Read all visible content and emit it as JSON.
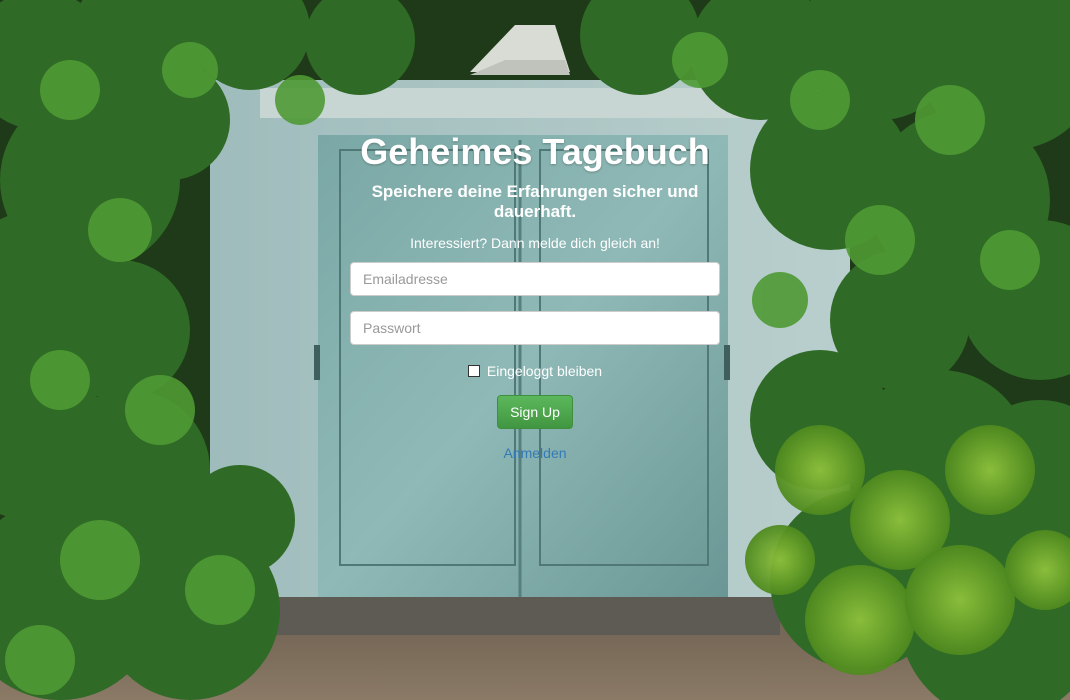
{
  "header": {
    "title": "Geheimes Tagebuch",
    "subtitle": "Speichere deine Erfahrungen sicher und dauerhaft.",
    "lead": "Interessiert? Dann melde dich gleich an!"
  },
  "form": {
    "email": {
      "value": "",
      "placeholder": "Emailadresse"
    },
    "password": {
      "value": "",
      "placeholder": "Passwort"
    },
    "remember_label": "Eingeloggt bleiben",
    "remember_checked": false,
    "submit_label": "Sign Up",
    "switch_link_label": "Anmelden"
  },
  "colors": {
    "button": "#5cb85c",
    "link": "#337ab7",
    "door": "#6f9e9c"
  }
}
